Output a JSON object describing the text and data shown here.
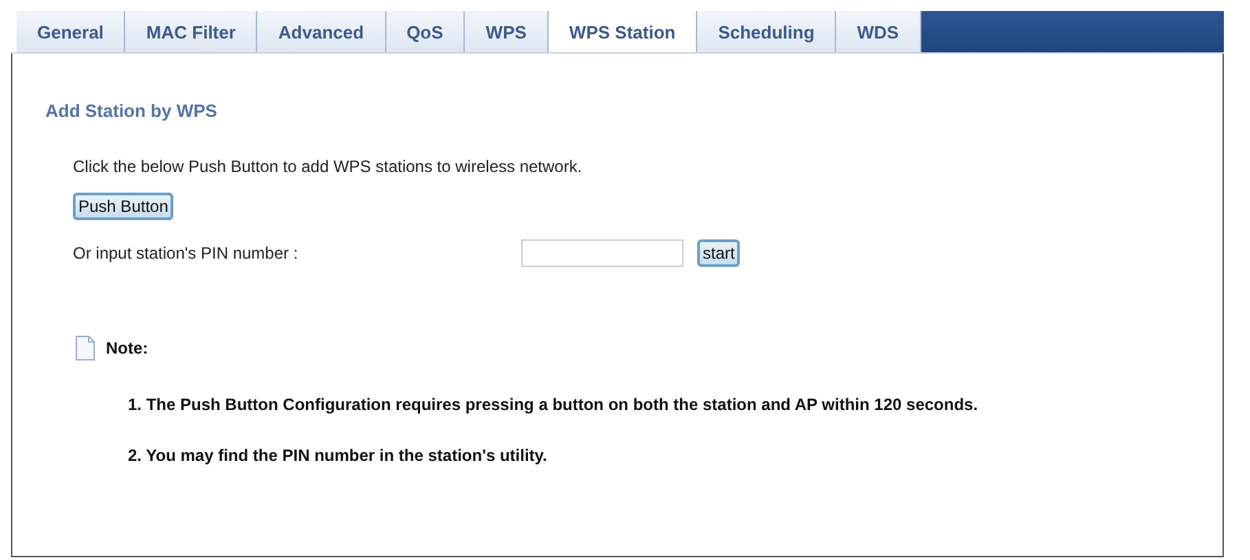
{
  "tabs": [
    {
      "label": "General",
      "selected": false
    },
    {
      "label": "MAC Filter",
      "selected": false
    },
    {
      "label": "Advanced",
      "selected": false
    },
    {
      "label": "QoS",
      "selected": false
    },
    {
      "label": "WPS",
      "selected": false
    },
    {
      "label": "WPS Station",
      "selected": true
    },
    {
      "label": "Scheduling",
      "selected": false
    },
    {
      "label": "WDS",
      "selected": false
    }
  ],
  "section_title": "Add Station by WPS",
  "description": "Click the below Push Button to add WPS stations to wireless network.",
  "push_button": "Push Button",
  "pin": {
    "label": "Or input station's PIN number :",
    "button": "start"
  },
  "note": {
    "title": "Note:",
    "items": [
      "1. The Push Button Configuration requires pressing a button on both the station and AP within 120 seconds.",
      "2. You may find the PIN number in the station's utility."
    ]
  }
}
